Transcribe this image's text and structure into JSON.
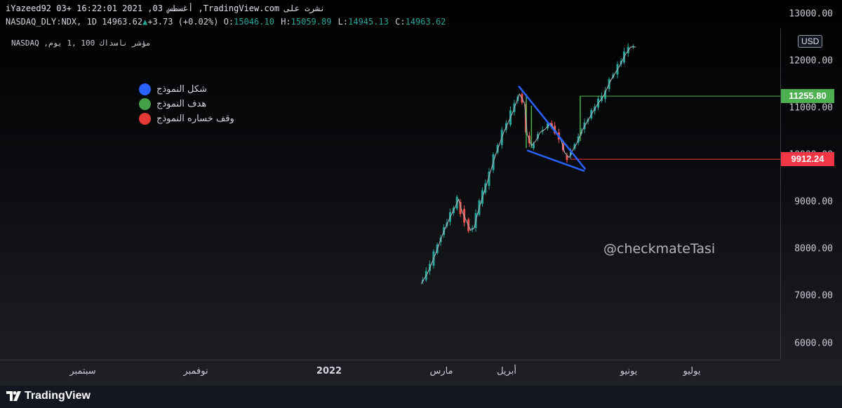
{
  "header": {
    "line1": "iYazeed92 03+ 16:22:01 2021 ,أغسطس 03 ,TradingView.com نشرت على",
    "symbol": "NASDAQ_DLY:NDX, 1D 14963.62",
    "change": "+3.73 (+0.02%)",
    "o_label": "O:",
    "o_value": "15046.10",
    "h_label": "H:",
    "h_value": "15059.89",
    "l_label": "L:",
    "l_value": "14945.13",
    "c_label": "C:",
    "c_value": "14963.62"
  },
  "instrument_label": "NASDAQ ,مؤشر ناسداك 100 ,1 يوم",
  "currency": "USD",
  "price_axis": {
    "ticks": [
      "6000.00",
      "7000.00",
      "8000.00",
      "9000.00",
      "10000.00",
      "11000.00",
      "12000.00",
      "13000.00"
    ]
  },
  "price_labels": {
    "target": "11255.80",
    "stop": "9912.24",
    "target_color": "#4caf50",
    "stop_color": "#f23645"
  },
  "time_axis": {
    "ticks": [
      "سبتمبر",
      "نوفمبر",
      "2022",
      "مارس",
      "أبريل",
      "يونيو",
      "يوليو"
    ]
  },
  "legend": [
    {
      "label": "شكل النموذج",
      "color": "#2962ff"
    },
    {
      "label": "هدف النموذج",
      "color": "#43a047"
    },
    {
      "label": "وقف خساره النموذج",
      "color": "#e53935"
    }
  ],
  "watermark": "@checkmateTasi",
  "footer": {
    "brand": "TradingView"
  },
  "colors": {
    "up": "#26a69a",
    "down": "#ef5350",
    "pattern_lines": "#2962ff",
    "target_line": "#4caf50",
    "stop_line": "#f23645"
  },
  "chart_data": {
    "type": "candlestick",
    "y_range": [
      5650,
      13300
    ],
    "y_scale": "linear",
    "grid": false,
    "price_path": [
      {
        "date": "2020-03-20",
        "value": 7260
      },
      {
        "date": "2020-03-28",
        "value": 7500
      },
      {
        "date": "2020-04-06",
        "value": 7900
      },
      {
        "date": "2020-04-14",
        "value": 8300
      },
      {
        "date": "2020-04-21",
        "value": 8600
      },
      {
        "date": "2020-04-29",
        "value": 8900
      },
      {
        "date": "2020-05-03",
        "value": 9060
      },
      {
        "date": "2020-05-07",
        "value": 8800
      },
      {
        "date": "2020-05-12",
        "value": 8600
      },
      {
        "date": "2020-05-17",
        "value": 8400
      },
      {
        "date": "2020-05-21",
        "value": 8450
      },
      {
        "date": "2020-05-25",
        "value": 8750
      },
      {
        "date": "2020-05-29",
        "value": 9000
      },
      {
        "date": "2020-06-05",
        "value": 9400
      },
      {
        "date": "2020-06-15",
        "value": 10000
      },
      {
        "date": "2020-06-25",
        "value": 10500
      },
      {
        "date": "2020-07-05",
        "value": 10900
      },
      {
        "date": "2020-07-13",
        "value": 11300
      },
      {
        "date": "2020-07-19",
        "value": 11100
      },
      {
        "date": "2020-07-22",
        "value": 10450
      },
      {
        "date": "2020-07-27",
        "value": 10200
      },
      {
        "date": "2020-08-01",
        "value": 10300
      },
      {
        "date": "2020-08-06",
        "value": 10480
      },
      {
        "date": "2020-08-12",
        "value": 10550
      },
      {
        "date": "2020-08-18",
        "value": 10680
      },
      {
        "date": "2020-08-25",
        "value": 10500
      },
      {
        "date": "2020-08-31",
        "value": 10300
      },
      {
        "date": "2020-09-04",
        "value": 10050
      },
      {
        "date": "2020-09-09",
        "value": 9950
      },
      {
        "date": "2020-09-13",
        "value": 10100
      },
      {
        "date": "2020-09-18",
        "value": 10250
      },
      {
        "date": "2020-09-25",
        "value": 10550
      },
      {
        "date": "2020-10-03",
        "value": 10800
      },
      {
        "date": "2020-10-11",
        "value": 11050
      },
      {
        "date": "2020-10-19",
        "value": 11250
      },
      {
        "date": "2020-10-28",
        "value": 11600
      },
      {
        "date": "2020-11-07",
        "value": 11900
      },
      {
        "date": "2020-11-14",
        "value": 12150
      },
      {
        "date": "2020-11-20",
        "value": 12300
      },
      {
        "date": "2020-11-26",
        "value": 12300
      }
    ],
    "annotations": {
      "pattern_upper_line": [
        {
          "date": "2020-07-12",
          "value": 11470
        },
        {
          "date": "2020-09-28",
          "value": 9700
        }
      ],
      "pattern_lower_line": [
        {
          "date": "2020-07-22",
          "value": 10100
        },
        {
          "date": "2020-09-27",
          "value": 9660
        }
      ],
      "target_level": 11255.8,
      "stop_level": 9912.24
    }
  }
}
